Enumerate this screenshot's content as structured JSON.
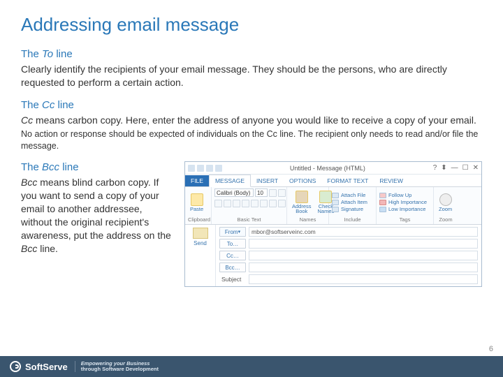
{
  "title": "Addressing email message",
  "to": {
    "head_pre": "The ",
    "head_it": "To",
    "head_post": " line",
    "body": "Clearly identify the recipients of your email message. They should be the persons, who are directly requested to perform a certain action."
  },
  "cc": {
    "head_pre": "The ",
    "head_it": "Cc",
    "head_post": " line",
    "body1_it": "Cc",
    "body1": " means carbon copy. Here, enter the address of anyone you would like to receive a copy of your email.",
    "body2_pre": "No action or response should be expected of individuals on the ",
    "body2_it": "Cc",
    "body2_post": " line. The recipient only needs to read and/or file the message."
  },
  "bcc": {
    "head_pre": "The ",
    "head_it": "Bcc",
    "head_post": " line",
    "body_it": "Bcc",
    "body_mid": " means blind carbon copy. If you want to send a copy of your email to another addressee, without the original recipient's awareness, put the address on the ",
    "body_it2": "Bcc",
    "body_end": " line."
  },
  "outlook": {
    "window_title": "Untitled - Message (HTML)",
    "tabs": {
      "file": "FILE",
      "message": "MESSAGE",
      "insert": "INSERT",
      "options": "OPTIONS",
      "format": "FORMAT TEXT",
      "review": "REVIEW"
    },
    "groups": {
      "clipboard": "Clipboard",
      "basic_text": "Basic Text",
      "names": "Names",
      "include": "Include",
      "tags": "Tags",
      "zoom": "Zoom"
    },
    "paste": "Paste",
    "font_name": "Calibri (Body)",
    "font_size": "10",
    "address_book": "Address Book",
    "check_names": "Check Names",
    "attach_file": "Attach File",
    "attach_item": "Attach Item",
    "signature": "Signature",
    "follow_up": "Follow Up",
    "high_imp": "High Importance",
    "low_imp": "Low Importance",
    "zoom": "Zoom",
    "send": "Send",
    "from_btn": "From",
    "to_btn": "To…",
    "cc_btn": "Cc…",
    "bcc_btn": "Bcc…",
    "subject_lbl": "Subject",
    "from_value": "mbor@softserveinc.com"
  },
  "footer": {
    "brand": "SoftServe",
    "tag1": "Empowering your Business",
    "tag2": "through Software Development"
  },
  "page_number": "6"
}
